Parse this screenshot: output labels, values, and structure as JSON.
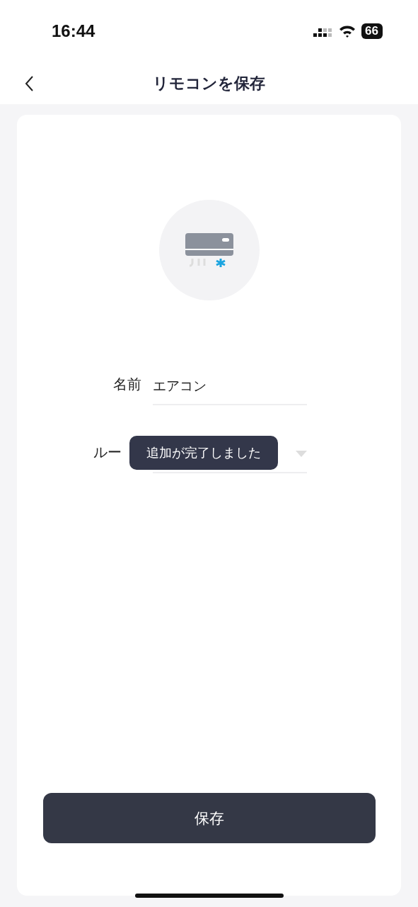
{
  "status_bar": {
    "time": "16:44",
    "battery": "66"
  },
  "header": {
    "title": "リモコンを保存"
  },
  "fields": [
    {
      "kind": "text",
      "label": "名前",
      "value": "エアコン"
    },
    {
      "kind": "select",
      "label": "ルー"
    }
  ],
  "toast": "追加が完了しました",
  "save_button": "保存"
}
